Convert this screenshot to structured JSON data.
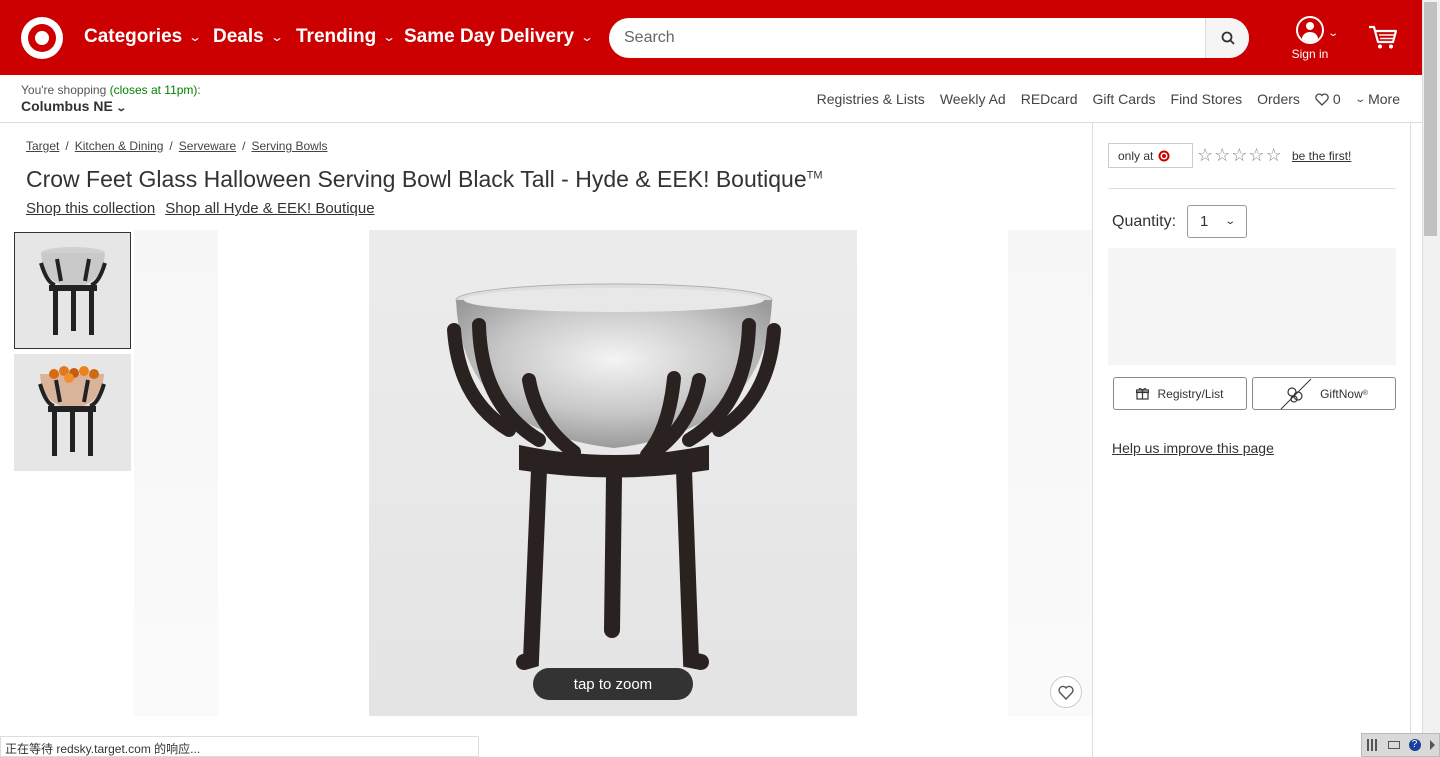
{
  "header": {
    "nav": [
      "Categories",
      "Deals",
      "Trending",
      "Same Day Delivery"
    ],
    "search_placeholder": "Search",
    "sign_in": "Sign in"
  },
  "subheader": {
    "shopping_prefix": "You're shopping",
    "closes": "(closes at 11pm)",
    "colon": ":",
    "store": "Columbus NE",
    "links": [
      "Registries & Lists",
      "Weekly Ad",
      "REDcard",
      "Gift Cards",
      "Find Stores",
      "Orders"
    ],
    "favorites_count": "0",
    "more": "More"
  },
  "breadcrumb": [
    "Target",
    "Kitchen & Dining",
    "Serveware",
    "Serving Bowls"
  ],
  "product": {
    "title": "Crow Feet Glass Halloween Serving Bowl Black Tall - Hyde & EEK! Boutique",
    "trademark": "TM",
    "shop_collection": "Shop this collection",
    "shop_brand": "Shop all Hyde & EEK! Boutique",
    "zoom_label": "tap to zoom"
  },
  "panel": {
    "only_at": "only at",
    "be_first": "be the first!",
    "quantity_label": "Quantity:",
    "quantity_value": "1",
    "registry_button": "Registry/List",
    "giftnow_button": "GiftNow",
    "help_link": "Help us improve this page"
  },
  "status_bar": "正在等待 redsky.target.com 的响应...",
  "colors": {
    "brand": "#cc0000",
    "open": "#008300"
  }
}
